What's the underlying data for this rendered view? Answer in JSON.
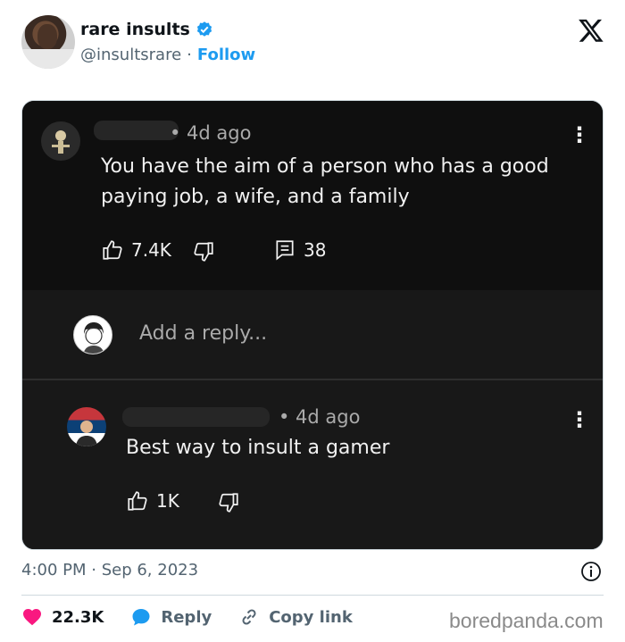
{
  "tweet": {
    "display_name": "rare insults",
    "handle": "@insultsrare",
    "separator": "·",
    "follow_label": "Follow",
    "timestamp": "4:00 PM · Sep 6, 2023",
    "likes": "22.3K",
    "reply_label": "Reply",
    "copy_link_label": "Copy link"
  },
  "screenshot": {
    "comment1": {
      "meta": "• 4d ago",
      "text_line1": "You have the aim of a person who has a good",
      "text_line2": "paying job, a wife, and a family",
      "likes": "7.4K",
      "replies": "38"
    },
    "reply_placeholder": "Add a reply...",
    "comment2": {
      "meta": "• 4d ago",
      "text": "Best way to insult a gamer",
      "likes": "1K"
    },
    "kebab": "⋮"
  },
  "watermark": "boredpanda.com",
  "colors": {
    "accent": "#1d9bf0",
    "like": "#f91880",
    "card_bg": "#0f0f0f"
  },
  "icons": [
    "verified-badge-icon",
    "x-logo-icon",
    "thumbs-up-icon",
    "thumbs-down-icon",
    "replies-icon",
    "kebab-menu-icon",
    "info-icon",
    "heart-icon",
    "reply-bubble-icon",
    "link-icon"
  ]
}
